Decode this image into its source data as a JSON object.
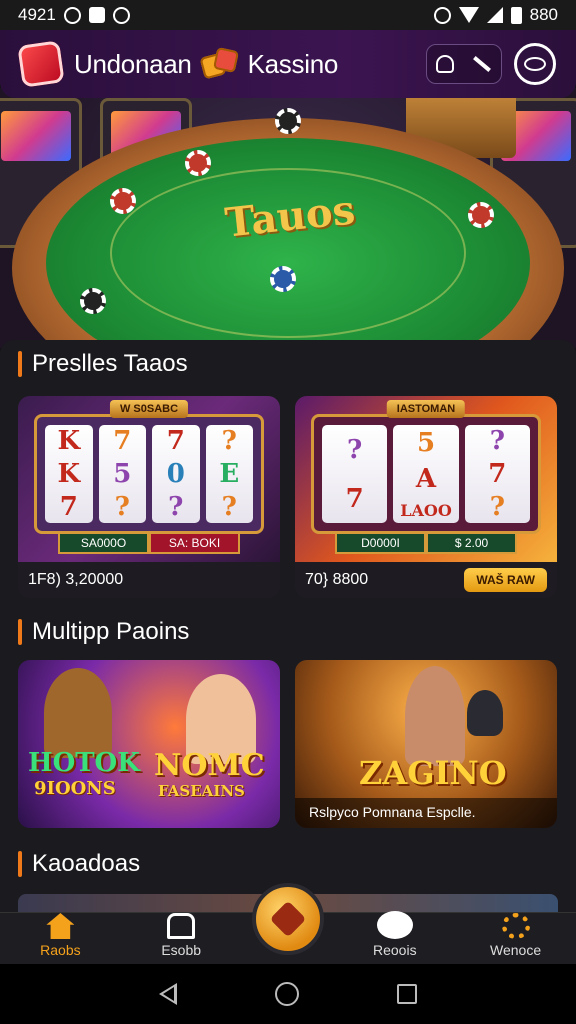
{
  "status_bar": {
    "left_text": "4921",
    "right_text": "880"
  },
  "header": {
    "brand_left": "Undonaan",
    "brand_right": "Kassino"
  },
  "hero": {
    "table_title": "Tauos"
  },
  "sections": [
    {
      "title": "Preslles Taaos"
    },
    {
      "title": "Multipp Paoins"
    },
    {
      "title": "Kaoadoas"
    }
  ],
  "slots": [
    {
      "badge": "W S0SABC",
      "reels": [
        "K",
        "K",
        "7",
        "7",
        "5",
        "?",
        "7",
        "0",
        "?",
        "?",
        "E",
        "?"
      ],
      "bar_left": "SA000O",
      "bar_right": "SA: BOKI",
      "footer": "1F8) 3,20000"
    },
    {
      "badge": "IASTOMAN",
      "reels": [
        "?",
        "7",
        "5",
        "A",
        "?",
        "?",
        "7",
        "LAOO",
        "?"
      ],
      "bar_left": "D0000I",
      "bar_right": "$ 2.00",
      "footer": "70} 8800",
      "button": "WAŠ RAW"
    }
  ],
  "promos": [
    {
      "title": "HOTOK",
      "subtitle": "9IOONS",
      "title2": "NOMC",
      "subtitle2": "FASEAINS"
    },
    {
      "title": "ZAGINO",
      "caption": "Rslpyco Pomnana Espclle."
    }
  ],
  "bottom_nav": [
    {
      "label": "Raobs",
      "active": true
    },
    {
      "label": "Esobb"
    },
    {
      "label": "Reoois"
    },
    {
      "label": "Wenoce"
    }
  ],
  "colors": {
    "accent": "#f4a21c",
    "header_bg": "#3b1450",
    "felt": "#1c8a34"
  }
}
